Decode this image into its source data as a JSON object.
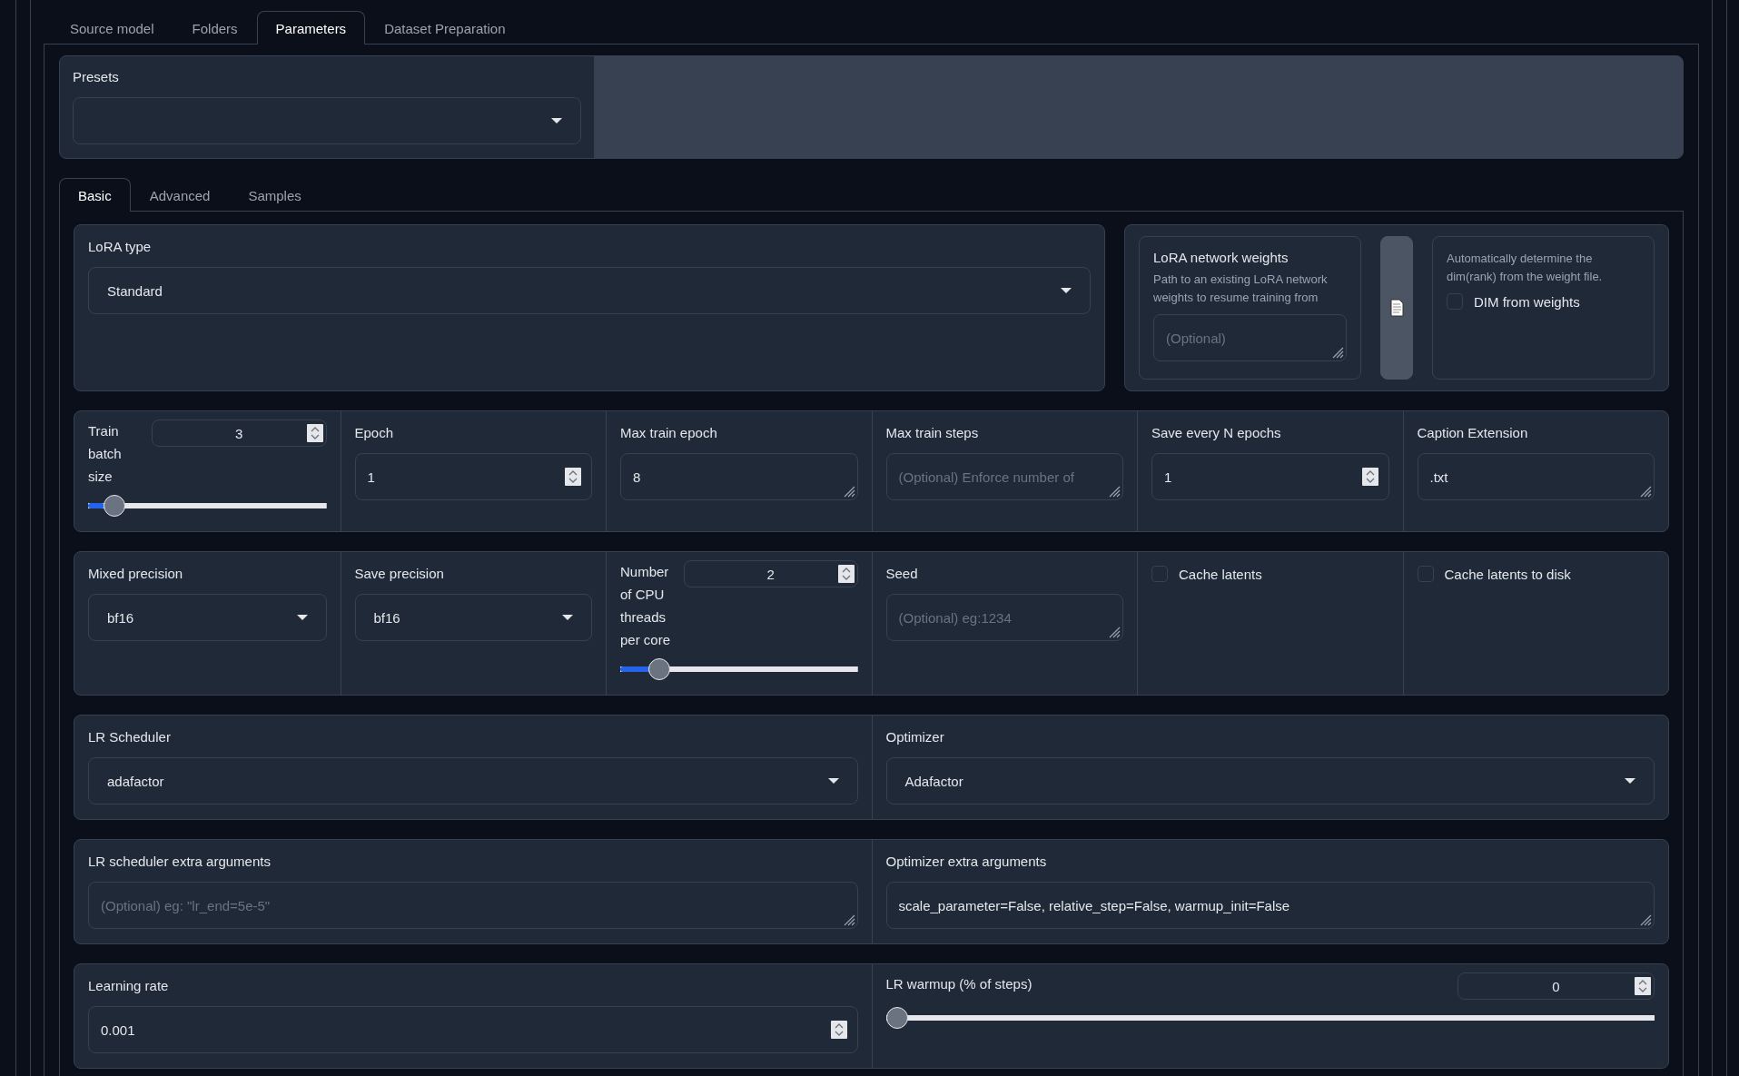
{
  "main_tabs": [
    {
      "label": "Source model",
      "selected": false
    },
    {
      "label": "Folders",
      "selected": false
    },
    {
      "label": "Parameters",
      "selected": true
    },
    {
      "label": "Dataset Preparation",
      "selected": false
    }
  ],
  "presets": {
    "label": "Presets"
  },
  "sub_tabs": [
    {
      "label": "Basic",
      "selected": true
    },
    {
      "label": "Advanced",
      "selected": false
    },
    {
      "label": "Samples",
      "selected": false
    }
  ],
  "lora_type": {
    "label": "LoRA type",
    "value": "Standard"
  },
  "network_weights": {
    "label": "LoRA network weights",
    "description": "Path to an existing LoRA network weights to resume training from",
    "placeholder": "(Optional)"
  },
  "dim_from_weights": {
    "description": "Automatically determine the dim(rank) from the weight file.",
    "label": "DIM from weights",
    "checked": false
  },
  "rows": [
    {
      "fields": [
        {
          "kind": "slider",
          "label": "Train batch size",
          "value": "3",
          "level": 0.07
        },
        {
          "kind": "number",
          "label": "Epoch",
          "value": "1"
        },
        {
          "kind": "text",
          "label": "Max train epoch",
          "value": "8"
        },
        {
          "kind": "text",
          "label": "Max train steps",
          "placeholder": "(Optional) Enforce number of"
        },
        {
          "kind": "number",
          "label": "Save every N epochs",
          "value": "1"
        },
        {
          "kind": "text",
          "label": "Caption Extension",
          "value": ".txt"
        }
      ]
    },
    {
      "fields": [
        {
          "kind": "dropdown",
          "label": "Mixed precision",
          "value": "bf16"
        },
        {
          "kind": "dropdown",
          "label": "Save precision",
          "value": "bf16"
        },
        {
          "kind": "slider",
          "label": "Number of CPU threads per core",
          "value": "2",
          "level": 0.13
        },
        {
          "kind": "text",
          "label": "Seed",
          "placeholder": "(Optional) eg:1234"
        },
        {
          "kind": "checkbox",
          "label": "Cache latents",
          "checked": false
        },
        {
          "kind": "checkbox",
          "label": "Cache latents to disk",
          "checked": false
        }
      ]
    },
    {
      "fields": [
        {
          "kind": "dropdown",
          "label": "LR Scheduler",
          "value": "adafactor"
        },
        {
          "kind": "dropdown",
          "label": "Optimizer",
          "value": "Adafactor"
        }
      ]
    },
    {
      "fields": [
        {
          "kind": "text",
          "label": "LR scheduler extra arguments",
          "placeholder": "(Optional) eg: \"lr_end=5e-5\""
        },
        {
          "kind": "text",
          "label": "Optimizer extra arguments",
          "value": "scale_parameter=False, relative_step=False, warmup_init=False"
        }
      ]
    },
    {
      "fields": [
        {
          "kind": "number",
          "label": "Learning rate",
          "value": "0.001"
        },
        {
          "kind": "slider",
          "label": "LR warmup (% of steps)",
          "value": "0",
          "level": 0
        }
      ]
    }
  ]
}
